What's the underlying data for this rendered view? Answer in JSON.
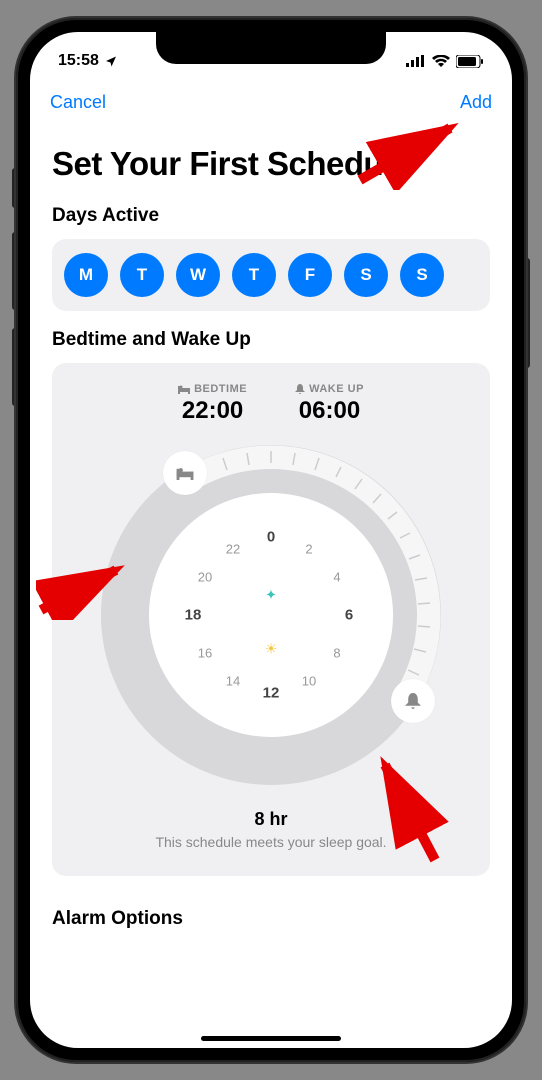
{
  "status": {
    "time": "15:58",
    "location_icon": "location-arrow"
  },
  "nav": {
    "cancel": "Cancel",
    "add": "Add"
  },
  "title": "Set Your First Schedule",
  "days": {
    "header": "Days Active",
    "items": [
      "M",
      "T",
      "W",
      "T",
      "F",
      "S",
      "S"
    ]
  },
  "bedtime": {
    "header": "Bedtime and Wake Up",
    "bedtime_label": "BEDTIME",
    "bedtime_value": "22:00",
    "wakeup_label": "WAKE UP",
    "wakeup_value": "06:00",
    "clock": {
      "top": "0",
      "right": "6",
      "bottom": "12",
      "left": "18",
      "ne1": "2",
      "ne2": "4",
      "se1": "8",
      "se2": "10",
      "sw1": "14",
      "sw2": "16",
      "nw1": "20",
      "nw2": "22"
    },
    "duration": "8 hr",
    "goal_text": "This schedule meets your sleep goal."
  },
  "alarm": {
    "header": "Alarm Options"
  },
  "colors": {
    "accent": "#007AFF"
  }
}
